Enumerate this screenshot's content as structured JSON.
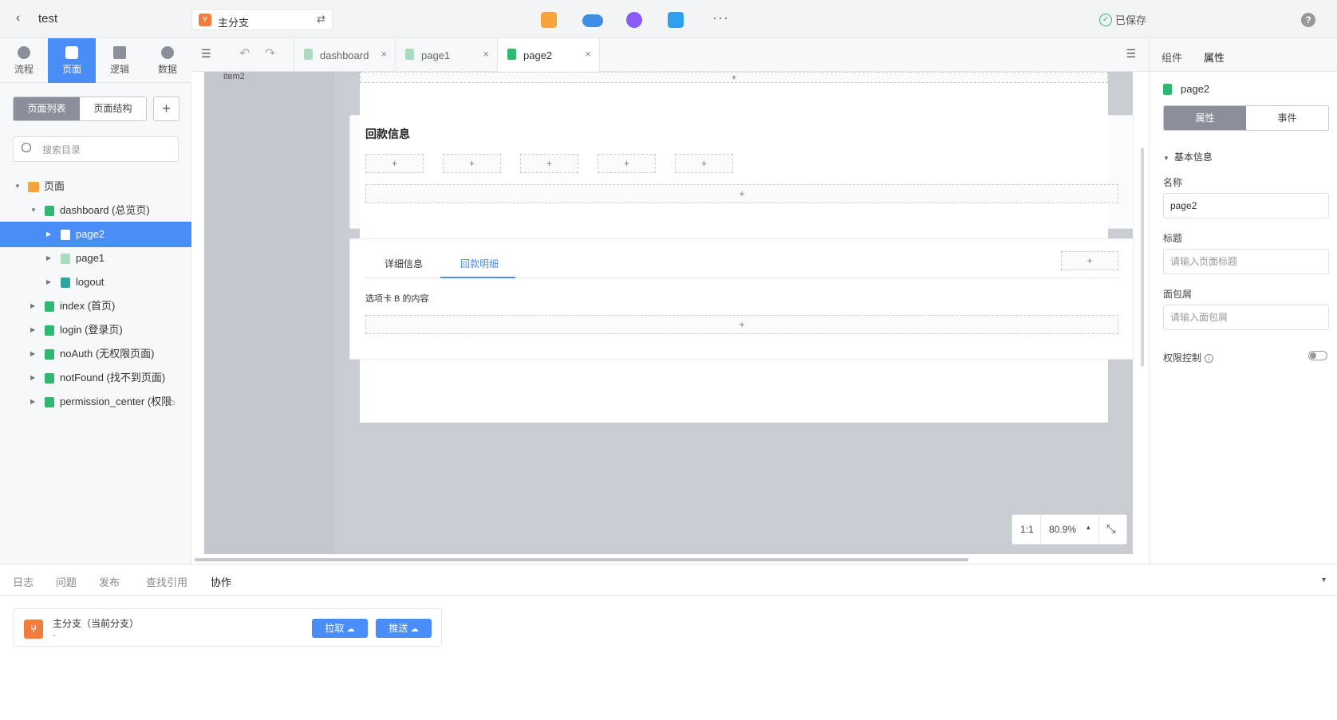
{
  "topbar": {
    "back_icon": "chevron-left-icon",
    "title": "test",
    "branch": "主分支",
    "swap_icon": "swap-icon",
    "saved": "已保存",
    "help": "?"
  },
  "leftnav": {
    "tabs": [
      {
        "label": "流程",
        "icon": "flow-icon"
      },
      {
        "label": "页面",
        "icon": "page-icon"
      },
      {
        "label": "逻辑",
        "icon": "logic-icon"
      },
      {
        "label": "数据",
        "icon": "data-icon"
      }
    ],
    "active": "页面"
  },
  "sidebar": {
    "segment": [
      "页面列表",
      "页面结构"
    ],
    "add": "+",
    "search_placeholder": "搜索目录",
    "tree": [
      {
        "label": "页面"
      },
      {
        "label": "dashboard (总览页)"
      },
      {
        "label": "page2"
      },
      {
        "label": "page1"
      },
      {
        "label": "logout"
      },
      {
        "label": "index (首页)"
      },
      {
        "label": "login (登录页)"
      },
      {
        "label": "noAuth (无权限页面)"
      },
      {
        "label": "notFound (找不到页面)"
      },
      {
        "label": "permission_center (权限"
      }
    ]
  },
  "editor": {
    "tabs": [
      {
        "label": "dashboard"
      },
      {
        "label": "page1"
      },
      {
        "label": "page2"
      }
    ],
    "close": "×",
    "outline_item": "item2",
    "plus": "+",
    "section1_title": "回款信息",
    "tab_labels": [
      "详细信息",
      "回款明细"
    ],
    "tab_content": "选项卡 B 的内容",
    "zoom": {
      "ratio": "1:1",
      "percent": "80.9%"
    }
  },
  "rpanel": {
    "tabs": [
      "组件",
      "属性"
    ],
    "file": "page2",
    "segment": [
      "属性",
      "事件"
    ],
    "section": "基本信息",
    "name_label": "名称",
    "name_value": "page2",
    "title_label": "标题",
    "title_placeholder": "请输入页面标题",
    "breadcrumb_label": "面包屑",
    "breadcrumb_placeholder": "请输入面包屑",
    "permission_label": "权限控制"
  },
  "bottom": {
    "tabs": [
      "日志",
      "问题",
      "发布",
      "查找引用",
      "协作"
    ],
    "branch_name": "主分支（当前分支）",
    "branch_sub": "-",
    "pull": "拉取",
    "push": "推送"
  },
  "colors": {
    "accent": "#4a8df6",
    "branch": "#f27b3e",
    "file": "#2eb872"
  }
}
